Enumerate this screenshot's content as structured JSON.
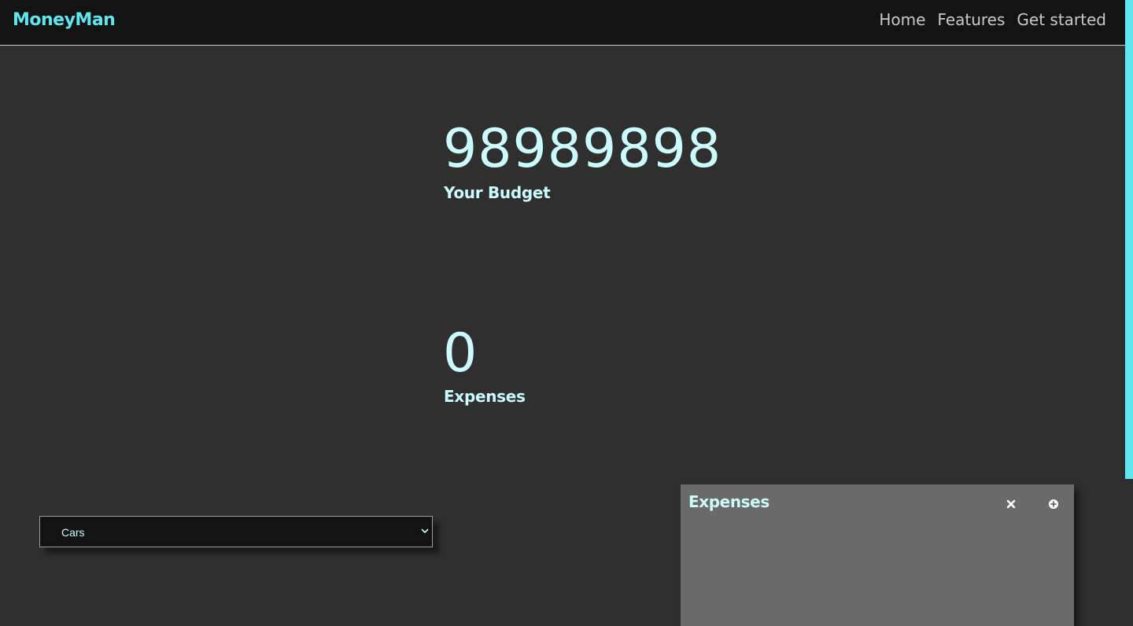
{
  "navbar": {
    "brand": "MoneyMan",
    "links": [
      "Home",
      "Features",
      "Get started"
    ]
  },
  "budget": {
    "value": "98989898",
    "label": "Your Budget"
  },
  "expenses": {
    "value": "0",
    "label": "Expenses"
  },
  "category_select": {
    "selected": "Cars"
  },
  "expenses_panel": {
    "title": "Expenses",
    "close_icon": "close-icon",
    "add_icon": "plus-circle-icon"
  },
  "colors": {
    "accent": "#5ee8ee",
    "text": "#ccfbfd",
    "background": "#2f2f2f",
    "navbar": "#131313",
    "panel": "#6a6a6a"
  }
}
